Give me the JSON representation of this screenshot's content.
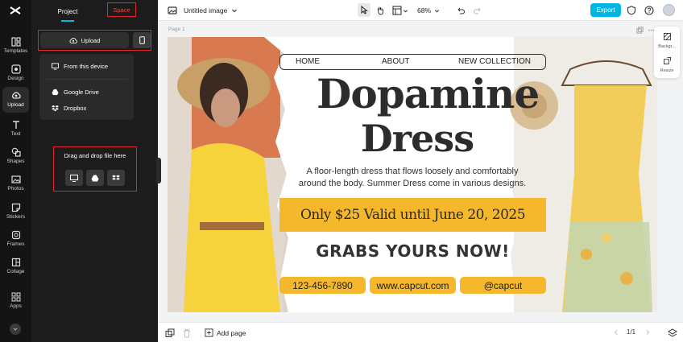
{
  "rail": {
    "items": [
      {
        "label": "Templates",
        "icon": "templates-icon"
      },
      {
        "label": "Design",
        "icon": "design-icon"
      },
      {
        "label": "Upload",
        "icon": "upload-icon"
      },
      {
        "label": "Text",
        "icon": "text-icon"
      },
      {
        "label": "Shapes",
        "icon": "shapes-icon"
      },
      {
        "label": "Photos",
        "icon": "photos-icon"
      },
      {
        "label": "Stickers",
        "icon": "stickers-icon"
      },
      {
        "label": "Frames",
        "icon": "frames-icon"
      },
      {
        "label": "Collage",
        "icon": "collage-icon"
      },
      {
        "label": "Apps",
        "icon": "apps-icon"
      }
    ],
    "active": "Upload"
  },
  "panel": {
    "tabs": {
      "project": "Project",
      "space": "Space"
    },
    "upload_label": "Upload",
    "menu": {
      "from_device": "From this device",
      "google_drive": "Google Drive",
      "dropbox": "Dropbox"
    },
    "dropzone": "Drag and drop file here"
  },
  "topbar": {
    "title": "Untitled image",
    "zoom": "68%",
    "export_label": "Export"
  },
  "canvas": {
    "page_label": "Page 1",
    "nav": {
      "home": "HOME",
      "about": "ABOUT",
      "collection": "NEW COLLECTION"
    },
    "headline1": "Dopamine",
    "headline2": "Dress",
    "desc1": "A floor-length dress that flows loosely and comfortably",
    "desc2": "around the body. Summer Dress come in various designs.",
    "price_banner": "Only $25 Valid until June 20, 2025",
    "cta": "GRABS YOURS NOW!",
    "phone": "123-456-7890",
    "website": "www.capcut.com",
    "handle": "@capcut"
  },
  "side_tools": {
    "background": "Backgr...",
    "resize": "Resize"
  },
  "bottombar": {
    "add_page": "Add page",
    "page_counter": "1/1"
  },
  "colors": {
    "accent": "#00b7e3",
    "banner": "#f5b82c"
  }
}
